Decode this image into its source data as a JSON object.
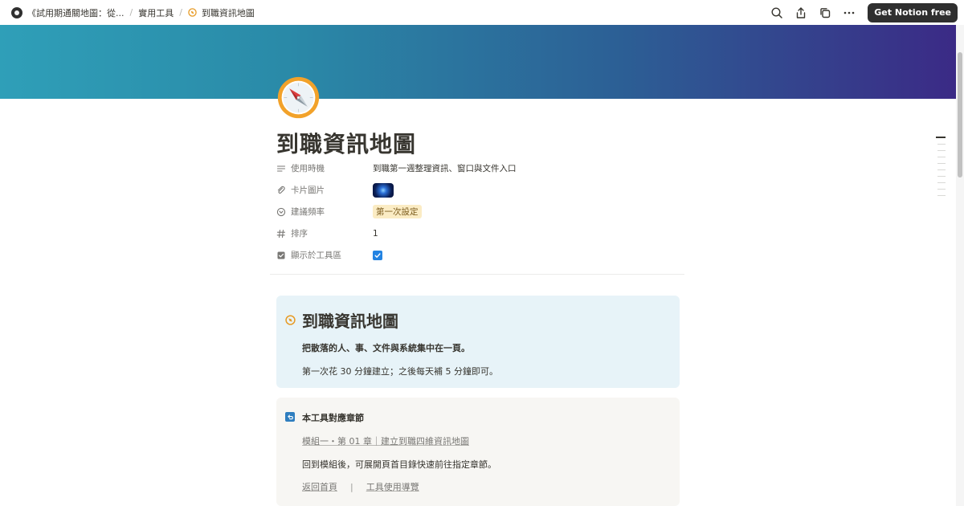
{
  "breadcrumb": {
    "items": [
      {
        "label": "《試用期通關地圖：從..."
      },
      {
        "label": "實用工具"
      },
      {
        "label": "到職資訊地圖"
      }
    ]
  },
  "topbar": {
    "cta_label": "Get Notion free",
    "icons": [
      "search-icon",
      "share-icon",
      "duplicate-icon",
      "more-icon"
    ]
  },
  "page": {
    "title": "到職資訊地圖",
    "icon": "compass-icon"
  },
  "properties": [
    {
      "key": "使用時機",
      "icon": "text-lines-icon",
      "value": "到職第一週整理資訊、窗口與文件入口"
    },
    {
      "key": "卡片圖片",
      "icon": "attachment-icon",
      "value": ""
    },
    {
      "key": "建議頻率",
      "icon": "select-icon",
      "value": "第一次設定"
    },
    {
      "key": "排序",
      "icon": "number-icon",
      "value": "1"
    },
    {
      "key": "顯示於工具區",
      "icon": "checkbox-icon",
      "value": true
    }
  ],
  "callout_main": {
    "title": "到職資訊地圖",
    "line1": "把散落的人、事、文件與系統集中在一頁。",
    "line2": "第一次花 30 分鐘建立；之後每天補 5 分鐘即可。"
  },
  "callout_chapter": {
    "title": "本工具對應章節",
    "link": "模組一・第 01 章｜建立到職四維資訊地圖",
    "text": "回到模組後，可展開頁首目錄快速前往指定章節。",
    "links": [
      "返回首頁",
      "工具使用導覽"
    ],
    "separator": "|"
  },
  "colors": {
    "accent": "#2383e2",
    "tag_bg": "#fbecc4",
    "callout_blue": "#e7f3f8",
    "callout_gray": "#f7f6f3",
    "cta_bg": "#2f2f2f"
  }
}
